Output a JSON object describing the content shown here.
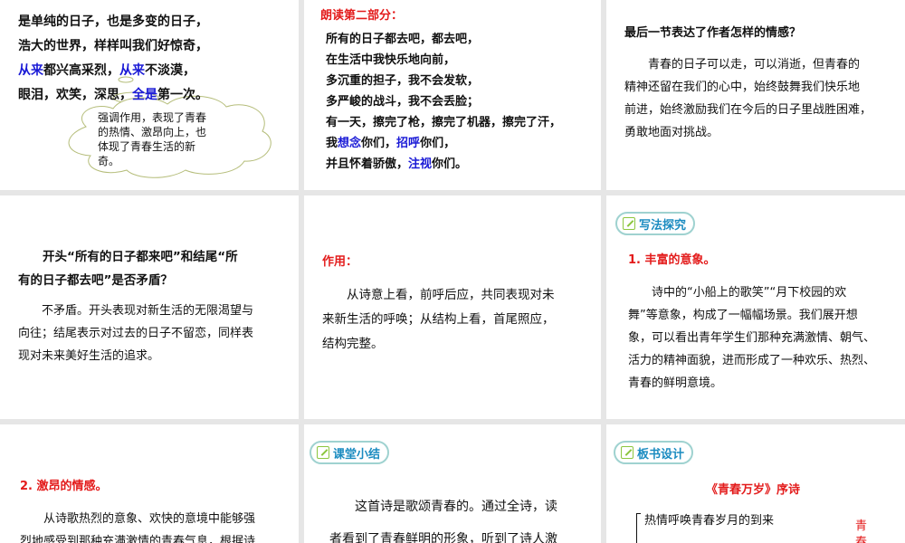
{
  "slide1": {
    "lines": [
      [
        {
          "t": "是单纯的日子，也是多变的日子，"
        }
      ],
      [
        {
          "t": "浩大的世界，样样叫我们好惊奇，"
        }
      ],
      [
        {
          "t": "从来",
          "c": "blue"
        },
        {
          "t": "都兴高采烈，"
        },
        {
          "t": "从来",
          "c": "blue"
        },
        {
          "t": "不淡漠，"
        }
      ],
      [
        {
          "t": "眼泪，欢笑，深思，"
        },
        {
          "t": "全是",
          "c": "blue"
        },
        {
          "t": "第一次。"
        }
      ]
    ],
    "callout": [
      "强调作用，表现了青春",
      "的热情、激昂向上，也",
      "体现了青春生活的新",
      "奇。"
    ]
  },
  "slide2": {
    "title": "朗读第二部分：",
    "lines": [
      [
        {
          "t": "所有的日子都去吧，都去吧，"
        }
      ],
      [
        {
          "t": "在生活中我快乐地向前，"
        }
      ],
      [
        {
          "t": "多沉重的担子，我不会发软，"
        }
      ],
      [
        {
          "t": "多严峻的战斗，我不会丢脸；"
        }
      ],
      [
        {
          "t": "有一天，擦完了枪，擦完了机器，擦完了汗，"
        }
      ],
      [
        {
          "t": "我"
        },
        {
          "t": "想念",
          "c": "blue"
        },
        {
          "t": "你们，"
        },
        {
          "t": "招呼",
          "c": "blue"
        },
        {
          "t": "你们，"
        }
      ],
      [
        {
          "t": "并且怀着骄傲，"
        },
        {
          "t": "注视",
          "c": "blue"
        },
        {
          "t": "你们。"
        }
      ]
    ]
  },
  "slide3": {
    "question": "最后一节表达了作者怎样的情感？",
    "answer": [
      "　　青春的日子可以走，可以消逝，但青春的",
      "精神还留在我们的心中，始终鼓舞我们快乐地",
      "前进，始终激励我们在今后的日子里战胜困难，",
      "勇敢地面对挑战。"
    ]
  },
  "slide4": {
    "question": [
      "　　开头“所有的日子都来吧”和结尾“所",
      "有的日子都去吧”是否矛盾？"
    ],
    "answer": [
      "　　不矛盾。开头表现对新生活的无限渴望与",
      "向往；结尾表示对过去的日子不留恋，同样表",
      "现对未来美好生活的追求。"
    ]
  },
  "slide5": {
    "label": "作用：",
    "answer": [
      "　　从诗意上看，前呼后应，共同表现对未",
      "来新生活的呼唤；从结构上看，首尾照应，",
      "结构完整。"
    ]
  },
  "slide6": {
    "badge": "写法探究",
    "heading": "1. 丰富的意象。",
    "para": [
      "　　诗中的“小船上的歌笑”“月下校园的欢",
      "舞”等意象，构成了一幅幅场景。我们展开想",
      "象，可以看出青年学生们那种充满激情、朝气、",
      "活力的精神面貌，进而形成了一种欢乐、热烈、",
      "青春的鲜明意境。"
    ]
  },
  "slide7": {
    "heading": "2. 激昂的情感。",
    "para": [
      "　　从诗歌热烈的意象、欢快的意境中能够强",
      "烈地感受到那种充满激情的青春气息，根据诗"
    ]
  },
  "slide8": {
    "badge": "课堂小结",
    "para": [
      "　　这首诗是歌颂青春的。通过全诗，读",
      "者看到了青春鲜明的形象，听到了诗人激"
    ]
  },
  "slide9": {
    "badge": "板书设计",
    "title": "《青春万岁》序诗",
    "item": "热情呼唤青春岁月的到来",
    "side": [
      "青",
      "春"
    ]
  },
  "colors": {
    "red": "#e31b1b",
    "blue": "#1a1ad6",
    "badge": "#1a8bc0"
  }
}
